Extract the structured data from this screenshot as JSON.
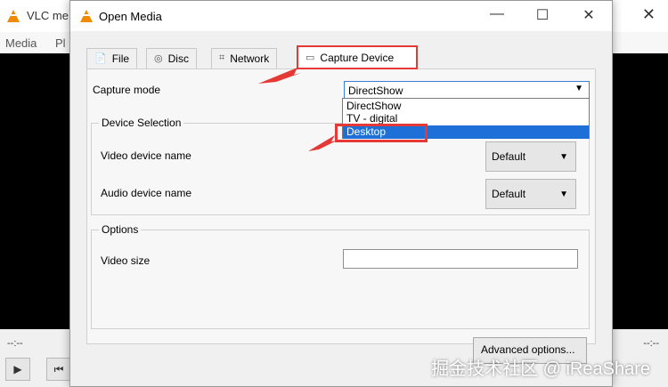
{
  "background": {
    "title": "VLC me",
    "menu": [
      "Media",
      "Pl"
    ],
    "time_left": "--:--",
    "time_right": "--:--"
  },
  "dialog": {
    "title": "Open Media",
    "window_controls": {
      "minimize": "—",
      "maximize": "☐",
      "close": "✕"
    },
    "tabs": [
      {
        "label": "File",
        "icon": "file-icon"
      },
      {
        "label": "Disc",
        "icon": "disc-icon"
      },
      {
        "label": "Network",
        "icon": "network-icon"
      },
      {
        "label": "Capture Device",
        "icon": "capture-device-icon",
        "active": true
      }
    ],
    "capture_mode": {
      "label": "Capture mode",
      "value": "DirectShow",
      "options": [
        "DirectShow",
        "TV - digital",
        "Desktop"
      ],
      "highlighted_option": "Desktop"
    },
    "device_selection": {
      "title": "Device Selection",
      "video_label": "Video device name",
      "video_value": "Default",
      "audio_label": "Audio device name",
      "audio_value": "Default"
    },
    "options": {
      "title": "Options",
      "video_size_label": "Video size",
      "video_size_value": ""
    },
    "advanced_button": "Advanced options..."
  },
  "watermark": "掘金技术社区 @ iReaShare",
  "colors": {
    "highlight_red": "#e53935",
    "selection_blue": "#1e6fd8",
    "vlc_orange": "#f08a00"
  }
}
